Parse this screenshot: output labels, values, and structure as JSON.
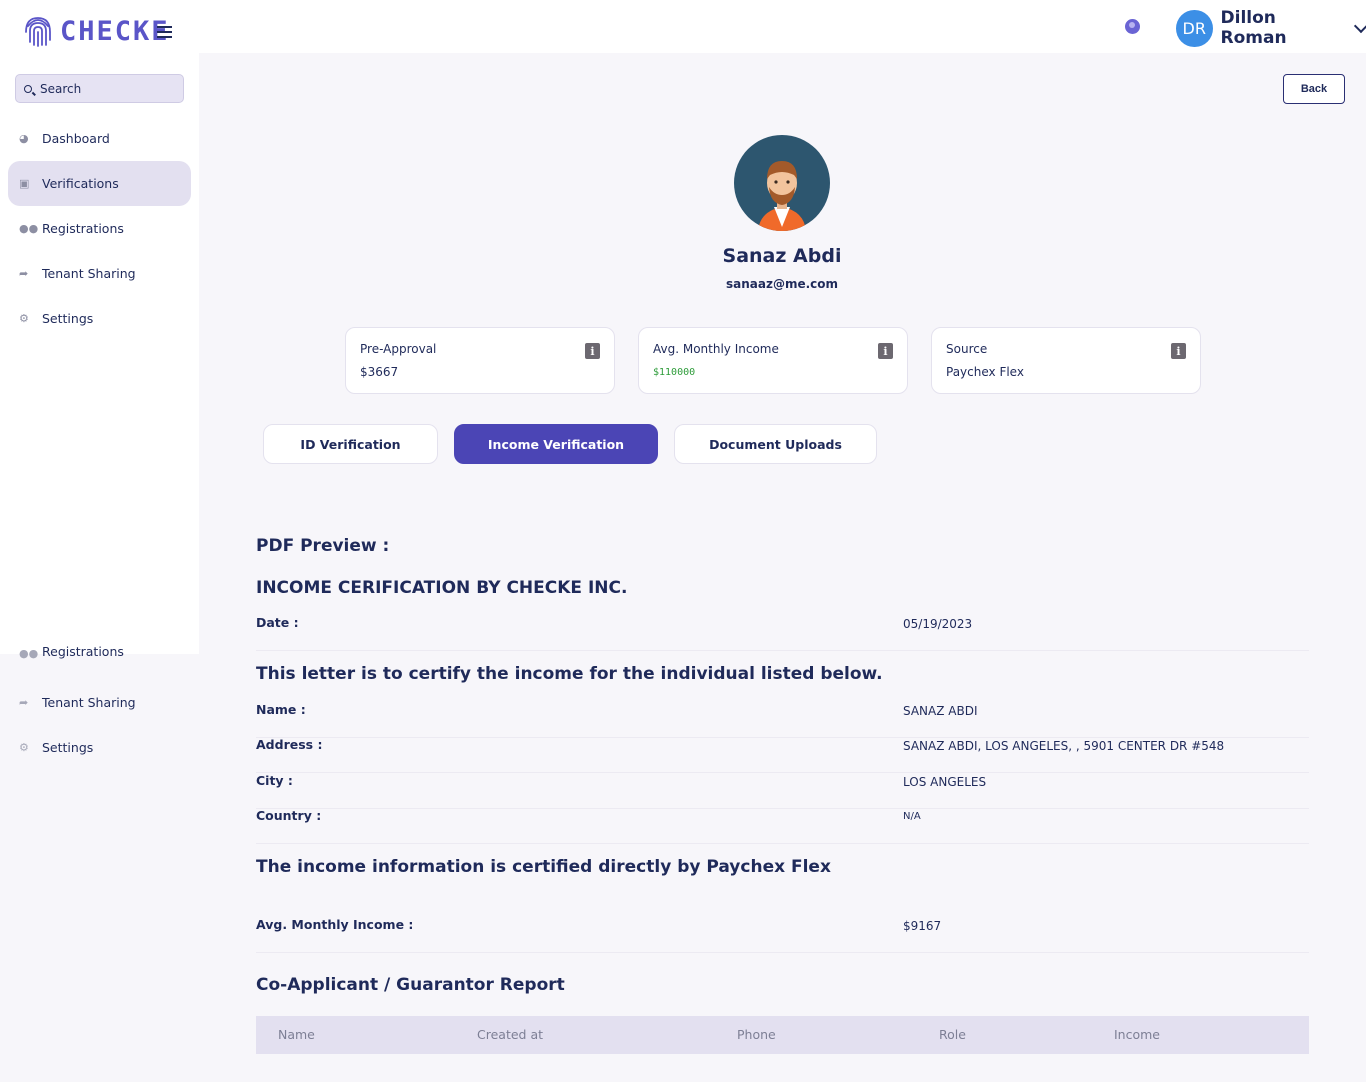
{
  "brand": {
    "name": "CHECKE"
  },
  "header": {
    "user_initials": "DR",
    "user_name": "Dillon Roman"
  },
  "sidebar": {
    "search_placeholder": "Search",
    "items": [
      {
        "label": "Dashboard",
        "icon": "dashboard-icon"
      },
      {
        "label": "Verifications",
        "icon": "verifications-icon",
        "active": true
      },
      {
        "label": "Registrations",
        "icon": "users-icon"
      },
      {
        "label": "Tenant Sharing",
        "icon": "share-icon"
      },
      {
        "label": "Settings",
        "icon": "gears-icon"
      }
    ],
    "ghost_items": [
      {
        "label": "Registrations"
      },
      {
        "label": "Tenant Sharing"
      },
      {
        "label": "Settings"
      }
    ]
  },
  "actions": {
    "back_label": "Back"
  },
  "profile": {
    "name": "Sanaz Abdi",
    "email": "sanaaz@me.com"
  },
  "stats": [
    {
      "label": "Pre-Approval",
      "value": "$3667"
    },
    {
      "label": "Avg. Monthly Income",
      "value": "$110000",
      "value_color": "#2e9c3a"
    },
    {
      "label": "Source",
      "value": "Paychex Flex"
    }
  ],
  "tabs": [
    {
      "label": "ID Verification"
    },
    {
      "label": "Income Verification",
      "active": true
    },
    {
      "label": "Document Uploads"
    }
  ],
  "pdf": {
    "preview_title": "PDF Preview :",
    "heading": "INCOME CERIFICATION BY CHECKE INC.",
    "date_label": "Date :",
    "date_value": "05/19/2023",
    "certify_text": "This letter is to certify the income for the individual listed below.",
    "name_label": "Name :",
    "name_value": "SANAZ ABDI",
    "address_label": "Address :",
    "address_value": "SANAZ ABDI, LOS ANGELES, , 5901 CENTER DR #548",
    "city_label": "City :",
    "city_value": "LOS ANGELES",
    "country_label": "Country :",
    "country_value": "N/A",
    "certified_by_text": "The income information is certified directly by Paychex Flex",
    "income_label": "Avg. Monthly Income :",
    "income_value": "$9167",
    "coapplicant_title": "Co-Applicant / Guarantor Report",
    "table_columns": [
      "Name",
      "Created at",
      "Phone",
      "Role",
      "Income"
    ]
  },
  "colors": {
    "accent": "#4b45b5",
    "brand": "#5a55c8",
    "text": "#1f2a5a"
  }
}
